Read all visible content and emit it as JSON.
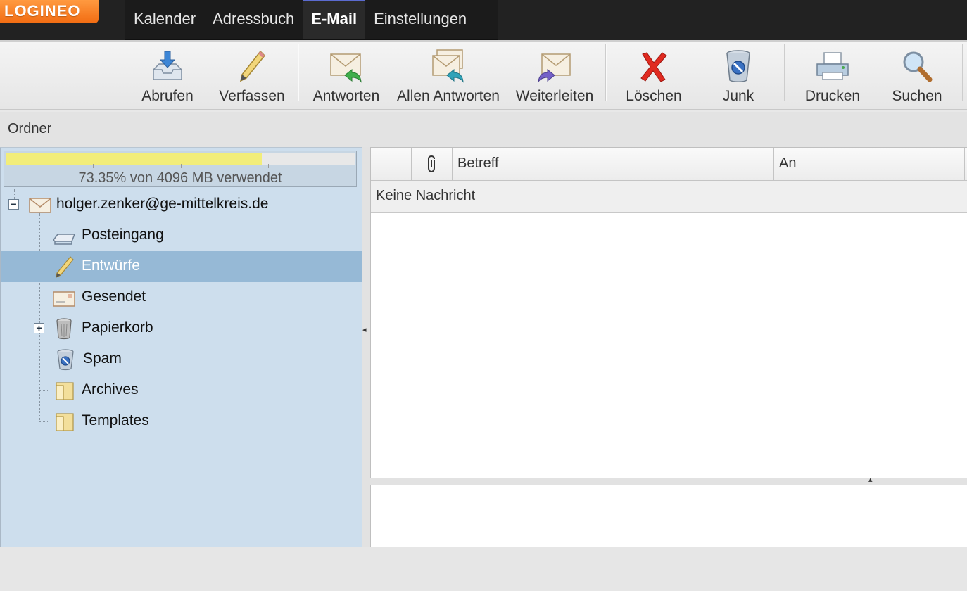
{
  "app": {
    "logo_text": "LOGINEO",
    "brand_color": "#f26c12"
  },
  "nav": {
    "items": [
      {
        "label": "Kalender",
        "active": false
      },
      {
        "label": "Adressbuch",
        "active": false
      },
      {
        "label": "E-Mail",
        "active": true
      },
      {
        "label": "Einstellungen",
        "active": false
      }
    ]
  },
  "toolbar": {
    "abrufen": {
      "label": "Abrufen",
      "icon": "inbox-download-icon"
    },
    "verfassen": {
      "label": "Verfassen",
      "icon": "pencil-icon"
    },
    "antworten": {
      "label": "Antworten",
      "icon": "reply-icon"
    },
    "allen_antworten": {
      "label": "Allen Antworten",
      "icon": "reply-all-icon"
    },
    "weiterleiten": {
      "label": "Weiterleiten",
      "icon": "forward-icon"
    },
    "loeschen": {
      "label": "Löschen",
      "icon": "delete-x-icon"
    },
    "junk": {
      "label": "Junk",
      "icon": "junk-bin-icon"
    },
    "drucken": {
      "label": "Drucken",
      "icon": "printer-icon"
    },
    "suchen": {
      "label": "Suchen",
      "icon": "magnifier-icon"
    }
  },
  "folders_header": {
    "label": "Ordner"
  },
  "quota": {
    "text": "73.35% von 4096 MB verwendet",
    "used_percent": 73.35
  },
  "account": {
    "email": "holger.zenker@ge-mittelkreis.de",
    "expanded": true
  },
  "folders": [
    {
      "name": "Posteingang",
      "icon": "inbox-tray-icon",
      "selected": false
    },
    {
      "name": "Entwürfe",
      "icon": "pencil-icon",
      "selected": true
    },
    {
      "name": "Gesendet",
      "icon": "envelope-icon",
      "selected": false
    },
    {
      "name": "Papierkorb",
      "icon": "trash-icon",
      "selected": false,
      "has_children": true
    },
    {
      "name": "Spam",
      "icon": "junk-bin-icon",
      "selected": false
    },
    {
      "name": "Archives",
      "icon": "folder-icon",
      "selected": false
    },
    {
      "name": "Templates",
      "icon": "folder-icon",
      "selected": false
    }
  ],
  "message_list": {
    "columns": {
      "attachment_icon": "paperclip-icon",
      "subject": "Betreff",
      "to": "An"
    },
    "empty_text": "Keine Nachricht"
  }
}
